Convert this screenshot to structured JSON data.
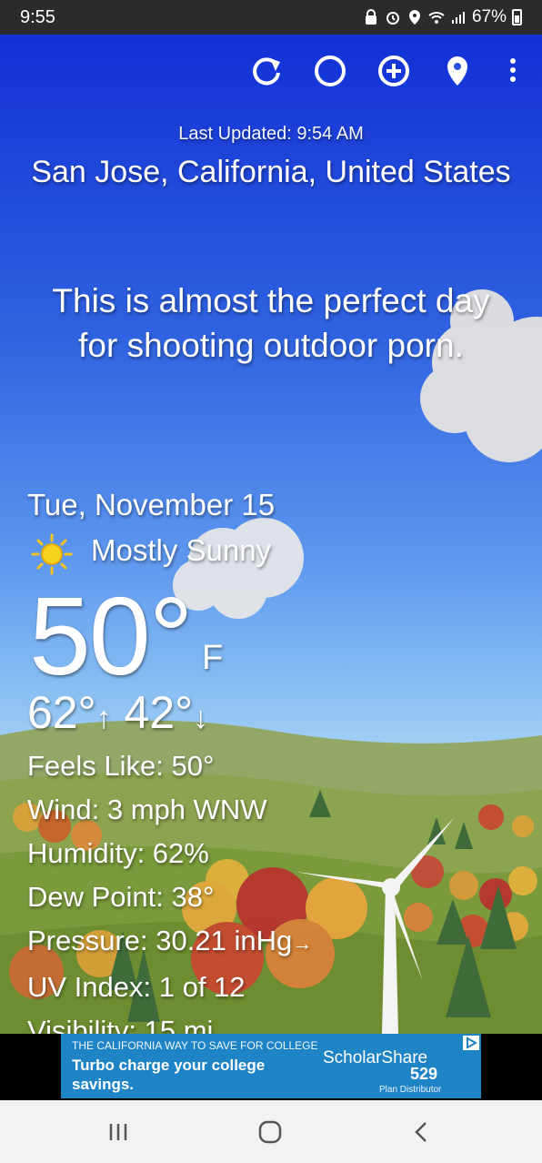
{
  "status_bar": {
    "time": "9:55",
    "battery": "67%",
    "icons": [
      "lock-icon",
      "alarm-icon",
      "location-icon",
      "wifi-icon",
      "signal-icon",
      "battery-icon"
    ]
  },
  "toolbar": {
    "icons": [
      "refresh-icon",
      "theme-icon",
      "add-location-icon",
      "location-pin-icon",
      "more-options-icon"
    ]
  },
  "weather": {
    "last_updated": "Last Updated: 9:54 AM",
    "location": "San Jose, California, United States",
    "tagline": "This is almost the perfect day for shooting outdoor porn.",
    "date": "Tue, November 15",
    "condition": "Mostly Sunny",
    "condition_icon": "sun-icon",
    "temperature": "50°",
    "unit": "F",
    "high": "62°",
    "high_arrow": "↑",
    "low": "42°",
    "low_arrow": "↓",
    "details": {
      "feels_like": "Feels Like:  50°",
      "wind": "Wind:  3 mph WNW",
      "humidity": "Humidity:  62%",
      "dew_point": "Dew Point:  38°",
      "pressure": "Pressure:  30.21 inHg",
      "pressure_arrow": "→",
      "uv_index": "UV Index:  1 of 12",
      "visibility": "Visibility:  15 mi"
    }
  },
  "ad": {
    "top_line": "THE CALIFORNIA WAY TO SAVE FOR COLLEGE",
    "headline": "Turbo charge your college savings.",
    "brand": "ScholarShare",
    "brand_number": "529",
    "sub": "Plan Distributor",
    "accent": "#1f84c6"
  },
  "nav_bar": {
    "icons": [
      "recent-apps-icon",
      "home-icon",
      "back-icon"
    ]
  }
}
